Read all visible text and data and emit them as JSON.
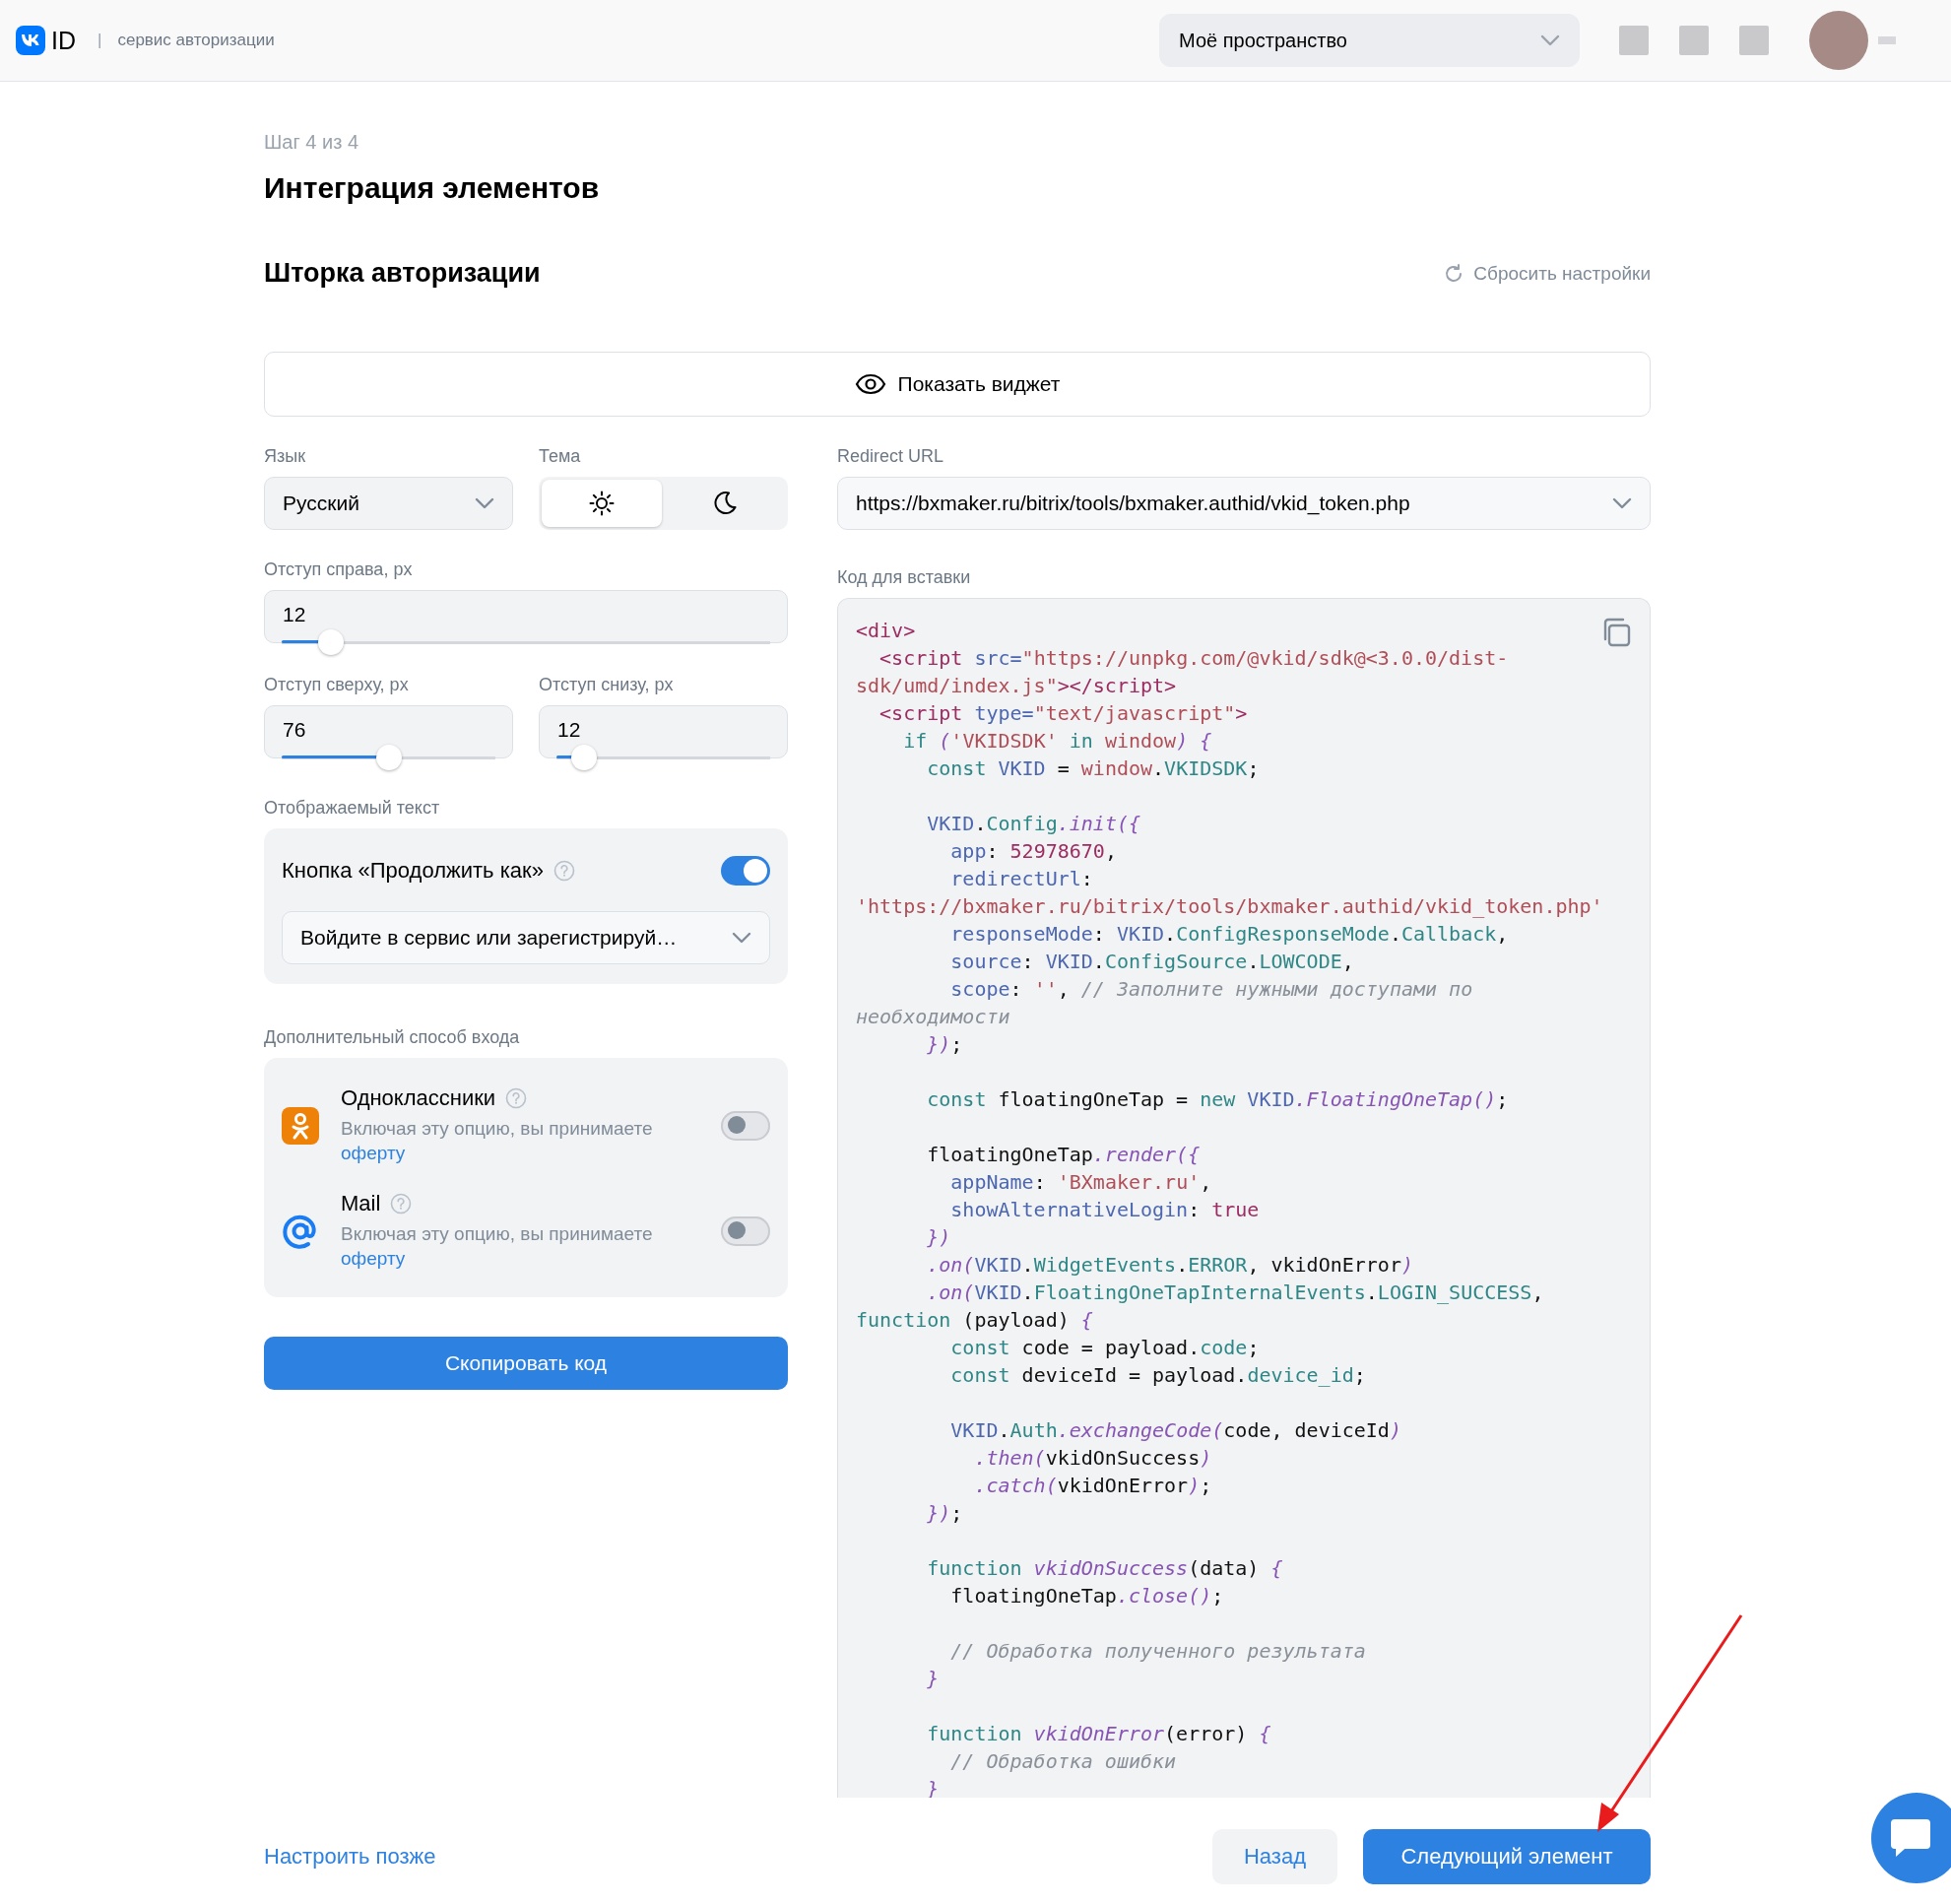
{
  "header": {
    "brand": "ID",
    "separator": "|",
    "service": "сервис авторизации",
    "workspace": "Моё пространство"
  },
  "step": "Шаг 4 из 4",
  "title": "Интеграция элементов",
  "section": {
    "title": "Шторка авторизации",
    "reset": "Сбросить настройки"
  },
  "show_widget": "Показать виджет",
  "language": {
    "label": "Язык",
    "value": "Русский"
  },
  "theme": {
    "label": "Тема",
    "options": [
      {
        "kind": "light",
        "selected": true
      },
      {
        "kind": "dark",
        "selected": false
      }
    ]
  },
  "offsets": [
    {
      "label": "Отступ справа, px",
      "value": "12",
      "level": 0.1
    },
    {
      "label": "Отступ сверху, px",
      "value": "76",
      "level": 0.5
    },
    {
      "label": "Отступ снизу, px",
      "value": "12",
      "level": 0.13
    }
  ],
  "display_text": {
    "label": "Отображаемый текст",
    "toggle_label": "Кнопка «Продолжить как»",
    "on": true,
    "value": "Войдите в сервис или зарегистрируй…"
  },
  "extra_login": {
    "label": "Дополнительный способ входа",
    "items": [
      {
        "kind": "ok",
        "name": "Одноклассники",
        "description": "Включая эту опцию, вы принимаете",
        "link": "оферту",
        "on": false
      },
      {
        "kind": "mail",
        "name": "Mail",
        "description": "Включая эту опцию, вы принимаете",
        "link": "оферту",
        "on": false
      }
    ]
  },
  "copy_button": "Скопировать код",
  "redirect": {
    "label": "Redirect URL",
    "value": "https://bxmaker.ru/bitrix/tools/bxmaker.authid/vkid_token.php"
  },
  "code": {
    "label": "Код для вставки",
    "blocks": [
      {
        "lines": [
          [
            {
              "kind": "m",
              "text": "<div>"
            }
          ],
          [
            {
              "kind": "m",
              "text": "  <script"
            },
            {
              "kind": "v",
              "text": " src="
            },
            {
              "kind": "s",
              "text": "\"https://unpkg.com/@vkid/sdk@<3.0.0/dist-"
            }
          ],
          [
            {
              "kind": "s",
              "text": "sdk/umd/index.js\""
            },
            {
              "kind": "m",
              "text": "></script>"
            }
          ],
          [
            {
              "kind": "m",
              "text": "  <script"
            },
            {
              "kind": "v",
              "text": " type="
            },
            {
              "kind": "s",
              "text": "\"text/javascript\""
            },
            {
              "kind": "m",
              "text": ">"
            }
          ],
          [
            {
              "kind": "t",
              "text": "    if"
            },
            {
              "kind": "f",
              "text": " ("
            },
            {
              "kind": "s",
              "text": "'VKIDSDK'"
            },
            {
              "kind": "t",
              "text": " in"
            },
            {
              "kind": "s",
              "text": " window"
            },
            {
              "kind": "f",
              "text": ") {"
            }
          ],
          [
            {
              "kind": "t",
              "text": "      const"
            },
            {
              "kind": "v",
              "text": " VKID"
            },
            {
              "kind": "p",
              "text": " = "
            },
            {
              "kind": "s",
              "text": "window"
            },
            {
              "kind": "p",
              "text": "."
            },
            {
              "kind": "t",
              "text": "VKIDSDK"
            },
            {
              "kind": "p",
              "text": ";"
            }
          ]
        ]
      },
      {
        "lines": [
          [
            {
              "kind": "v",
              "text": "      VKID"
            },
            {
              "kind": "p",
              "text": "."
            },
            {
              "kind": "t",
              "text": "Config"
            },
            {
              "kind": "f",
              "text": ".init({"
            }
          ],
          [
            {
              "kind": "v",
              "text": "        app"
            },
            {
              "kind": "p",
              "text": ": "
            },
            {
              "kind": "m",
              "text": "52978670"
            },
            {
              "kind": "p",
              "text": ","
            }
          ],
          [
            {
              "kind": "v",
              "text": "        redirectUrl"
            },
            {
              "kind": "p",
              "text": ":"
            }
          ],
          [
            {
              "kind": "s",
              "text": "'https://bxmaker.ru/bitrix/tools/bxmaker.authid/vkid_token.php'"
            }
          ],
          [
            {
              "kind": "v",
              "text": "        responseMode"
            },
            {
              "kind": "p",
              "text": ": "
            },
            {
              "kind": "v",
              "text": "VKID"
            },
            {
              "kind": "p",
              "text": "."
            },
            {
              "kind": "t",
              "text": "ConfigResponseMode"
            },
            {
              "kind": "p",
              "text": "."
            },
            {
              "kind": "t",
              "text": "Callback"
            },
            {
              "kind": "p",
              "text": ","
            }
          ],
          [
            {
              "kind": "v",
              "text": "        source"
            },
            {
              "kind": "p",
              "text": ": "
            },
            {
              "kind": "v",
              "text": "VKID"
            },
            {
              "kind": "p",
              "text": "."
            },
            {
              "kind": "t",
              "text": "ConfigSource"
            },
            {
              "kind": "p",
              "text": "."
            },
            {
              "kind": "t",
              "text": "LOWCODE"
            },
            {
              "kind": "p",
              "text": ","
            }
          ],
          [
            {
              "kind": "v",
              "text": "        scope"
            },
            {
              "kind": "p",
              "text": ": "
            },
            {
              "kind": "s",
              "text": "''"
            },
            {
              "kind": "p",
              "text": ", "
            },
            {
              "kind": "c",
              "text": "// Заполните нужными доступами по"
            }
          ],
          [
            {
              "kind": "c",
              "text": "необходимости"
            }
          ],
          [
            {
              "kind": "f",
              "text": "      })"
            },
            {
              "kind": "p",
              "text": ";"
            }
          ]
        ]
      },
      {
        "lines": [
          [
            {
              "kind": "t",
              "text": "      const"
            },
            {
              "kind": "p",
              "text": " floatingOneTap = "
            },
            {
              "kind": "t",
              "text": "new"
            },
            {
              "kind": "v",
              "text": " VKID"
            },
            {
              "kind": "f",
              "text": ".FloatingOneTap()"
            },
            {
              "kind": "p",
              "text": ";"
            }
          ]
        ]
      },
      {
        "lines": [
          [
            {
              "kind": "p",
              "text": "      floatingOneTap"
            },
            {
              "kind": "f",
              "text": ".render({"
            }
          ],
          [
            {
              "kind": "v",
              "text": "        appName"
            },
            {
              "kind": "p",
              "text": ": "
            },
            {
              "kind": "s",
              "text": "'BXmaker.ru'"
            },
            {
              "kind": "p",
              "text": ","
            }
          ],
          [
            {
              "kind": "v",
              "text": "        showAlternativeLogin"
            },
            {
              "kind": "p",
              "text": ": "
            },
            {
              "kind": "m",
              "text": "true"
            }
          ],
          [
            {
              "kind": "f",
              "text": "      })"
            }
          ],
          [
            {
              "kind": "f",
              "text": "      .on("
            },
            {
              "kind": "v",
              "text": "VKID"
            },
            {
              "kind": "p",
              "text": "."
            },
            {
              "kind": "t",
              "text": "WidgetEvents"
            },
            {
              "kind": "p",
              "text": "."
            },
            {
              "kind": "t",
              "text": "ERROR"
            },
            {
              "kind": "p",
              "text": ", vkidOnError"
            },
            {
              "kind": "f",
              "text": ")"
            }
          ],
          [
            {
              "kind": "f",
              "text": "      .on("
            },
            {
              "kind": "v",
              "text": "VKID"
            },
            {
              "kind": "p",
              "text": "."
            },
            {
              "kind": "t",
              "text": "FloatingOneTapInternalEvents"
            },
            {
              "kind": "p",
              "text": "."
            },
            {
              "kind": "t",
              "text": "LOGIN_SUCCESS"
            },
            {
              "kind": "p",
              "text": ","
            }
          ],
          [
            {
              "kind": "t",
              "text": "function"
            },
            {
              "kind": "p",
              "text": " (payload) "
            },
            {
              "kind": "f",
              "text": "{"
            }
          ],
          [
            {
              "kind": "t",
              "text": "        const"
            },
            {
              "kind": "p",
              "text": " code = payload."
            },
            {
              "kind": "t",
              "text": "code"
            },
            {
              "kind": "p",
              "text": ";"
            }
          ],
          [
            {
              "kind": "t",
              "text": "        const"
            },
            {
              "kind": "p",
              "text": " deviceId = payload."
            },
            {
              "kind": "t",
              "text": "device_id"
            },
            {
              "kind": "p",
              "text": ";"
            }
          ]
        ]
      },
      {
        "lines": [
          [
            {
              "kind": "v",
              "text": "        VKID"
            },
            {
              "kind": "p",
              "text": "."
            },
            {
              "kind": "t",
              "text": "Auth"
            },
            {
              "kind": "f",
              "text": ".exchangeCode("
            },
            {
              "kind": "p",
              "text": "code, deviceId"
            },
            {
              "kind": "f",
              "text": ")"
            }
          ],
          [
            {
              "kind": "f",
              "text": "          .then("
            },
            {
              "kind": "p",
              "text": "vkidOnSuccess"
            },
            {
              "kind": "f",
              "text": ")"
            }
          ],
          [
            {
              "kind": "f",
              "text": "          .catch("
            },
            {
              "kind": "p",
              "text": "vkidOnError"
            },
            {
              "kind": "f",
              "text": ")"
            },
            {
              "kind": "p",
              "text": ";"
            }
          ],
          [
            {
              "kind": "f",
              "text": "      })"
            },
            {
              "kind": "p",
              "text": ";"
            }
          ]
        ]
      },
      {
        "lines": [
          [
            {
              "kind": "t",
              "text": "      function"
            },
            {
              "kind": "f",
              "text": " vkidOnSuccess"
            },
            {
              "kind": "p",
              "text": "(data) "
            },
            {
              "kind": "f",
              "text": "{"
            }
          ],
          [
            {
              "kind": "p",
              "text": "        floatingOneTap"
            },
            {
              "kind": "f",
              "text": ".close()"
            },
            {
              "kind": "p",
              "text": ";"
            }
          ]
        ]
      },
      {
        "lines": [
          [
            {
              "kind": "c",
              "text": "        // Обработка полученного результата"
            }
          ],
          [
            {
              "kind": "f",
              "text": "      }"
            }
          ]
        ]
      },
      {
        "lines": [
          [
            {
              "kind": "t",
              "text": "      function"
            },
            {
              "kind": "f",
              "text": " vkidOnError"
            },
            {
              "kind": "p",
              "text": "(error) "
            },
            {
              "kind": "f",
              "text": "{"
            }
          ],
          [
            {
              "kind": "c",
              "text": "        // Обработка ошибки"
            }
          ],
          [
            {
              "kind": "f",
              "text": "      }"
            }
          ]
        ]
      }
    ]
  },
  "footer": {
    "later": "Настроить позже",
    "back": "Назад",
    "next": "Следующий элемент"
  }
}
